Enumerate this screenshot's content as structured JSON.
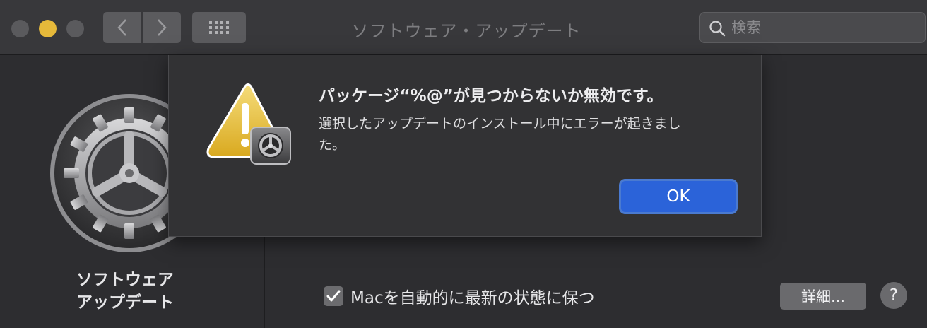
{
  "window": {
    "title": "ソフトウェア・アップデート",
    "search_placeholder": "検索"
  },
  "icons": {
    "back": "chevron-left-icon",
    "forward": "chevron-right-icon",
    "grid": "grid-icon",
    "search": "search-icon",
    "gear": "gear-icon",
    "warning": "warning-icon",
    "check": "checkmark-icon"
  },
  "pane": {
    "label_line1": "ソフトウェア",
    "label_line2": "アップデート"
  },
  "controls": {
    "auto_update_label": "Macを自動的に最新の状態に保つ",
    "auto_update_checked": true,
    "details_button": "詳細...",
    "help_button": "?"
  },
  "dialog": {
    "title": "パッケージ“%@”が見つからないか無効です。",
    "message": "選択したアップデートのインストール中にエラーが起きました。",
    "ok_button": "OK"
  },
  "colors": {
    "accent": "#2b63d9",
    "minimize": "#e6b93a",
    "background": "#2d2d30"
  }
}
